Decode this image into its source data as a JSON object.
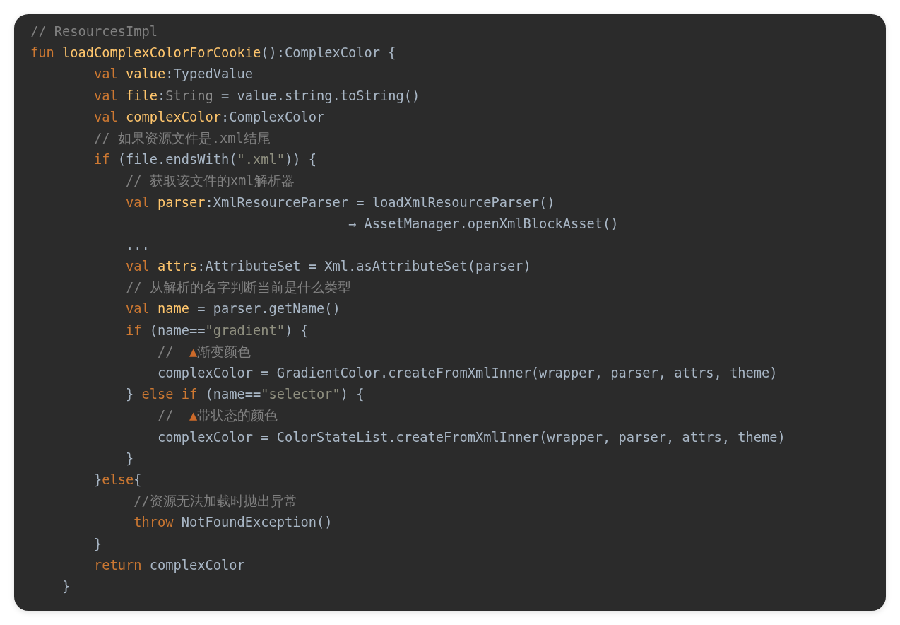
{
  "code_lines": [
    {
      "tokens": [
        {
          "kind": "comment",
          "text": "// ResourcesImpl"
        }
      ]
    },
    {
      "tokens": [
        {
          "kind": "keyword",
          "text": "fun "
        },
        {
          "kind": "decl",
          "text": "loadComplexColorForCookie"
        },
        {
          "kind": "plain",
          "text": "():ComplexColor {"
        }
      ]
    },
    {
      "tokens": [
        {
          "kind": "keyword",
          "text": "        val "
        },
        {
          "kind": "decl",
          "text": "value"
        },
        {
          "kind": "plain",
          "text": ":TypedValue"
        }
      ]
    },
    {
      "tokens": [
        {
          "kind": "keyword",
          "text": "        val "
        },
        {
          "kind": "decl",
          "text": "file"
        },
        {
          "kind": "plain",
          "text": ":"
        },
        {
          "kind": "muted",
          "text": "String"
        },
        {
          "kind": "plain",
          "text": " = value.string.toString()"
        }
      ]
    },
    {
      "tokens": [
        {
          "kind": "keyword",
          "text": "        val "
        },
        {
          "kind": "decl",
          "text": "complexColor"
        },
        {
          "kind": "plain",
          "text": ":ComplexColor"
        }
      ]
    },
    {
      "tokens": [
        {
          "kind": "comment",
          "text": "        // 如果资源文件是.xml结尾"
        }
      ]
    },
    {
      "tokens": [
        {
          "kind": "keyword",
          "text": "        if"
        },
        {
          "kind": "plain",
          "text": " (file.endsWith("
        },
        {
          "kind": "string",
          "text": "\".xml\""
        },
        {
          "kind": "plain",
          "text": ")) {"
        }
      ]
    },
    {
      "tokens": [
        {
          "kind": "comment",
          "text": "            // 获取该文件的xml解析器"
        }
      ]
    },
    {
      "tokens": [
        {
          "kind": "keyword",
          "text": "            val "
        },
        {
          "kind": "decl",
          "text": "parser"
        },
        {
          "kind": "plain",
          "text": ":XmlResourceParser = loadXmlResourceParser()"
        }
      ]
    },
    {
      "tokens": [
        {
          "kind": "plain",
          "text": "                                        → AssetManager.openXmlBlockAsset()"
        }
      ]
    },
    {
      "tokens": [
        {
          "kind": "plain",
          "text": "            ..."
        }
      ]
    },
    {
      "tokens": [
        {
          "kind": "keyword",
          "text": "            val "
        },
        {
          "kind": "decl",
          "text": "attrs"
        },
        {
          "kind": "plain",
          "text": ":AttributeSet = Xml.asAttributeSet(parser)"
        }
      ]
    },
    {
      "tokens": [
        {
          "kind": "comment",
          "text": "            // 从解析的名字判断当前是什么类型"
        }
      ]
    },
    {
      "tokens": [
        {
          "kind": "keyword",
          "text": "            val "
        },
        {
          "kind": "decl",
          "text": "name"
        },
        {
          "kind": "plain",
          "text": " = parser.getName()"
        }
      ]
    },
    {
      "tokens": [
        {
          "kind": "keyword",
          "text": "            if"
        },
        {
          "kind": "plain",
          "text": " (name=="
        },
        {
          "kind": "string",
          "text": "\"gradient\""
        },
        {
          "kind": "plain",
          "text": ") {"
        }
      ]
    },
    {
      "tokens": [
        {
          "kind": "comment",
          "text": "                //  "
        },
        {
          "kind": "mark",
          "text": "▲"
        },
        {
          "kind": "comment",
          "text": "渐变颜色"
        }
      ]
    },
    {
      "tokens": [
        {
          "kind": "plain",
          "text": "                complexColor = GradientColor.createFromXmlInner(wrapper, parser, attrs, theme)"
        }
      ]
    },
    {
      "tokens": [
        {
          "kind": "plain",
          "text": "            } "
        },
        {
          "kind": "keyword",
          "text": "else if"
        },
        {
          "kind": "plain",
          "text": " (name=="
        },
        {
          "kind": "string",
          "text": "\"selector\""
        },
        {
          "kind": "plain",
          "text": ") {"
        }
      ]
    },
    {
      "tokens": [
        {
          "kind": "comment",
          "text": "                //  "
        },
        {
          "kind": "mark",
          "text": "▲"
        },
        {
          "kind": "comment",
          "text": "带状态的颜色"
        }
      ]
    },
    {
      "tokens": [
        {
          "kind": "plain",
          "text": "                complexColor = ColorStateList.createFromXmlInner(wrapper, parser, attrs, theme)"
        }
      ]
    },
    {
      "tokens": [
        {
          "kind": "plain",
          "text": "            }"
        }
      ]
    },
    {
      "tokens": [
        {
          "kind": "plain",
          "text": "        }"
        },
        {
          "kind": "keyword",
          "text": "else"
        },
        {
          "kind": "plain",
          "text": "{"
        }
      ]
    },
    {
      "tokens": [
        {
          "kind": "comment",
          "text": "             //资源无法加载时抛出异常"
        }
      ]
    },
    {
      "tokens": [
        {
          "kind": "keyword",
          "text": "             throw"
        },
        {
          "kind": "plain",
          "text": " NotFoundException()"
        }
      ]
    },
    {
      "tokens": [
        {
          "kind": "plain",
          "text": "        }"
        }
      ]
    },
    {
      "tokens": [
        {
          "kind": "keyword",
          "text": "        return"
        },
        {
          "kind": "plain",
          "text": " complexColor"
        }
      ]
    },
    {
      "tokens": [
        {
          "kind": "plain",
          "text": "    }"
        }
      ]
    }
  ]
}
